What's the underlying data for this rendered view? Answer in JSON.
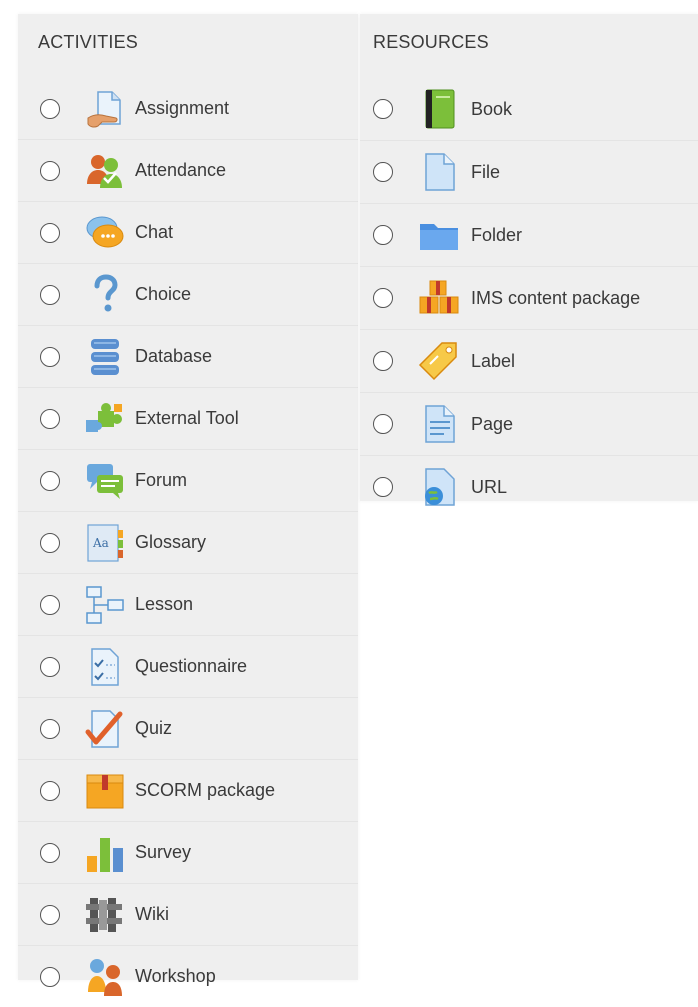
{
  "activities": {
    "heading": "ACTIVITIES",
    "items": [
      {
        "label": "Assignment",
        "icon": "assignment-icon"
      },
      {
        "label": "Attendance",
        "icon": "attendance-icon"
      },
      {
        "label": "Chat",
        "icon": "chat-icon"
      },
      {
        "label": "Choice",
        "icon": "choice-icon"
      },
      {
        "label": "Database",
        "icon": "database-icon"
      },
      {
        "label": "External Tool",
        "icon": "external-tool-icon"
      },
      {
        "label": "Forum",
        "icon": "forum-icon"
      },
      {
        "label": "Glossary",
        "icon": "glossary-icon"
      },
      {
        "label": "Lesson",
        "icon": "lesson-icon"
      },
      {
        "label": "Questionnaire",
        "icon": "questionnaire-icon"
      },
      {
        "label": "Quiz",
        "icon": "quiz-icon"
      },
      {
        "label": "SCORM package",
        "icon": "scorm-package-icon"
      },
      {
        "label": "Survey",
        "icon": "survey-icon"
      },
      {
        "label": "Wiki",
        "icon": "wiki-icon"
      },
      {
        "label": "Workshop",
        "icon": "workshop-icon"
      }
    ]
  },
  "resources": {
    "heading": "RESOURCES",
    "items": [
      {
        "label": "Book",
        "icon": "book-icon"
      },
      {
        "label": "File",
        "icon": "file-icon"
      },
      {
        "label": "Folder",
        "icon": "folder-icon"
      },
      {
        "label": "IMS content package",
        "icon": "ims-content-package-icon"
      },
      {
        "label": "Label",
        "icon": "label-icon"
      },
      {
        "label": "Page",
        "icon": "page-icon"
      },
      {
        "label": "URL",
        "icon": "url-icon"
      }
    ]
  },
  "colors": {
    "panel_bg": "#efefef",
    "text": "#3a3a3a",
    "divider": "#e4e4e4"
  }
}
